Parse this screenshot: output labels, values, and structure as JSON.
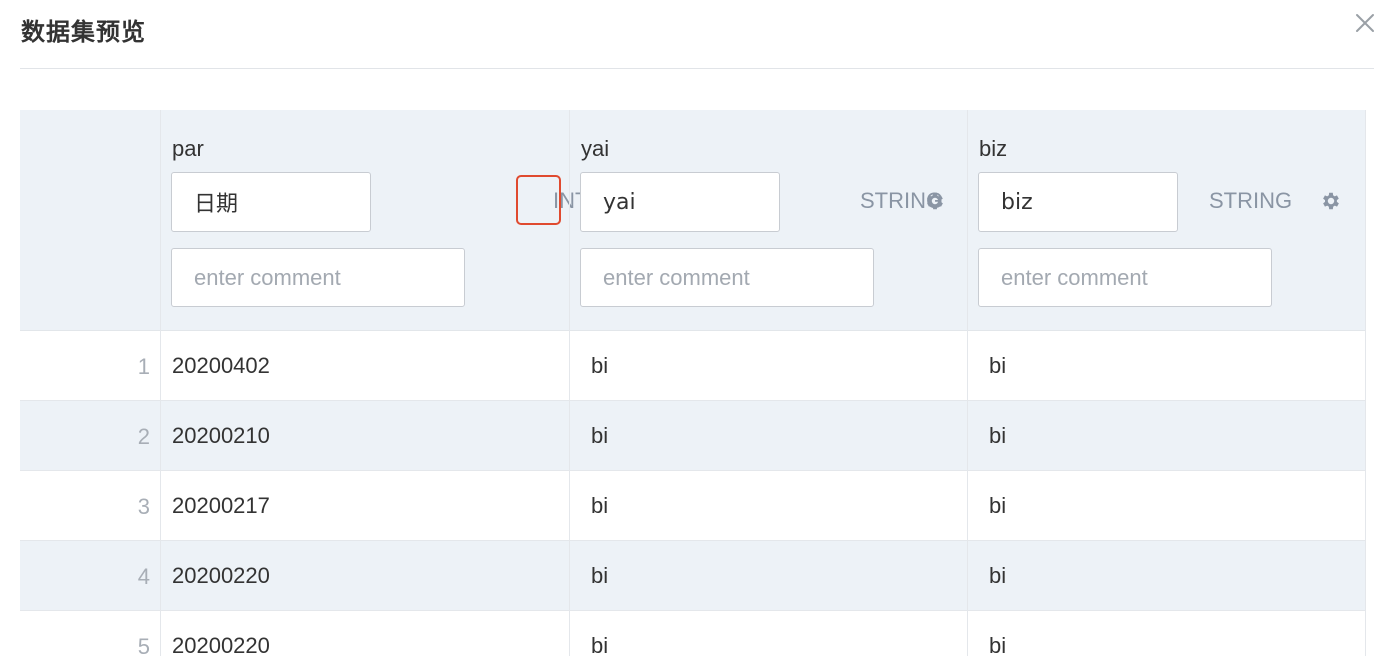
{
  "dialog": {
    "title": "数据集预览",
    "close_icon": "close-icon"
  },
  "columns": [
    {
      "name": "par",
      "alias": "日期",
      "type": "INT_DATE",
      "comment_placeholder": "enter comment",
      "settings_icon": "gear-icon",
      "highlighted": true
    },
    {
      "name": "yai",
      "alias": "yai",
      "type": "STRING",
      "comment_placeholder": "enter comment",
      "settings_icon": "gear-icon",
      "highlighted": false
    },
    {
      "name": "biz",
      "alias": "biz",
      "type": "STRING",
      "comment_placeholder": "enter comment",
      "settings_icon": "gear-icon",
      "highlighted": false
    }
  ],
  "rows": [
    {
      "index": "1",
      "cells": [
        "20200402",
        "bi",
        "bi"
      ]
    },
    {
      "index": "2",
      "cells": [
        "20200210",
        "bi",
        "bi"
      ]
    },
    {
      "index": "3",
      "cells": [
        "20200217",
        "bi",
        "bi"
      ]
    },
    {
      "index": "4",
      "cells": [
        "20200220",
        "bi",
        "bi"
      ]
    },
    {
      "index": "5",
      "cells": [
        "20200220",
        "bi",
        "bi"
      ]
    }
  ],
  "colors": {
    "header_bg": "#edf2f7",
    "type_label": "#8a95a4",
    "highlight": "#e04a2f"
  }
}
